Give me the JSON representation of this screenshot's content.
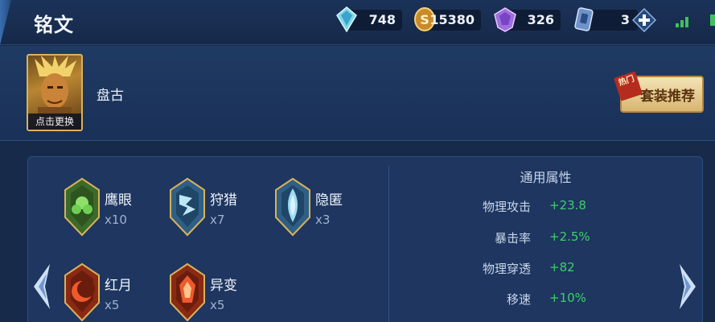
{
  "header": {
    "title": "铭文"
  },
  "resources": [
    {
      "icon": "diamond-crystal-icon",
      "value": "748"
    },
    {
      "icon": "gold-coin-icon",
      "value": "15380"
    },
    {
      "icon": "purple-gem-icon",
      "value": "326"
    },
    {
      "icon": "ticket-card-icon",
      "value": "3"
    }
  ],
  "hero": {
    "name": "盘古",
    "change_label": "点击更换"
  },
  "recommend": {
    "tag": "热门",
    "label": "套装推荐"
  },
  "runes": [
    {
      "name": "鹰眼",
      "count": "x10",
      "color": "#5fbf5a"
    },
    {
      "name": "狩猎",
      "count": "x7",
      "color": "#7fc8e8"
    },
    {
      "name": "隐匿",
      "count": "x3",
      "color": "#8fd1f0"
    },
    {
      "name": "红月",
      "count": "x5",
      "color": "#e0552e"
    },
    {
      "name": "异变",
      "count": "x5",
      "color": "#e0552e"
    }
  ],
  "stats": {
    "title": "通用属性",
    "rows": [
      {
        "name": "物理攻击",
        "value": "+23.8"
      },
      {
        "name": "暴击率",
        "value": "+2.5%"
      },
      {
        "name": "物理穿透",
        "value": "+82"
      },
      {
        "name": "移速",
        "value": "+10%"
      }
    ]
  },
  "colors": {
    "accent_gold": "#d9b25a",
    "stat_green": "#3fcf6a",
    "panel_bg": "#1e3660"
  }
}
